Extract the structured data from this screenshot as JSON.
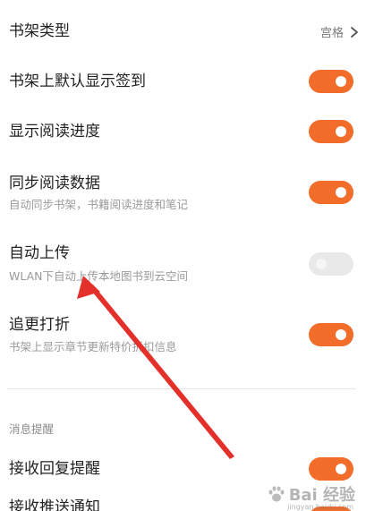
{
  "settings": {
    "items": [
      {
        "title": "书架类型",
        "value": "宫格"
      },
      {
        "title": "书架上默认显示签到",
        "enabled": true
      },
      {
        "title": "显示阅读进度",
        "enabled": true
      },
      {
        "title": "同步阅读数据",
        "subtitle": "自动同步书架，书籍阅读进度和笔记",
        "enabled": true
      },
      {
        "title": "自动上传",
        "subtitle": "WLAN下自动上传本地图书到云空间",
        "enabled": false
      },
      {
        "title": "追更打折",
        "subtitle": "书架上显示章节更新特价折扣信息",
        "enabled": true
      }
    ],
    "notifications_header": "消息提醒",
    "notification_items": [
      {
        "title": "接收回复提醒",
        "enabled": true
      },
      {
        "title": "接收推送通知",
        "enabled": true
      }
    ]
  },
  "colors": {
    "toggle_on": "#f26c2a",
    "toggle_off": "#e9e9e9",
    "arrow": "#e3302a"
  },
  "watermark": {
    "text": "Bai 经验",
    "subtext": "jingyan.baidu.com"
  }
}
